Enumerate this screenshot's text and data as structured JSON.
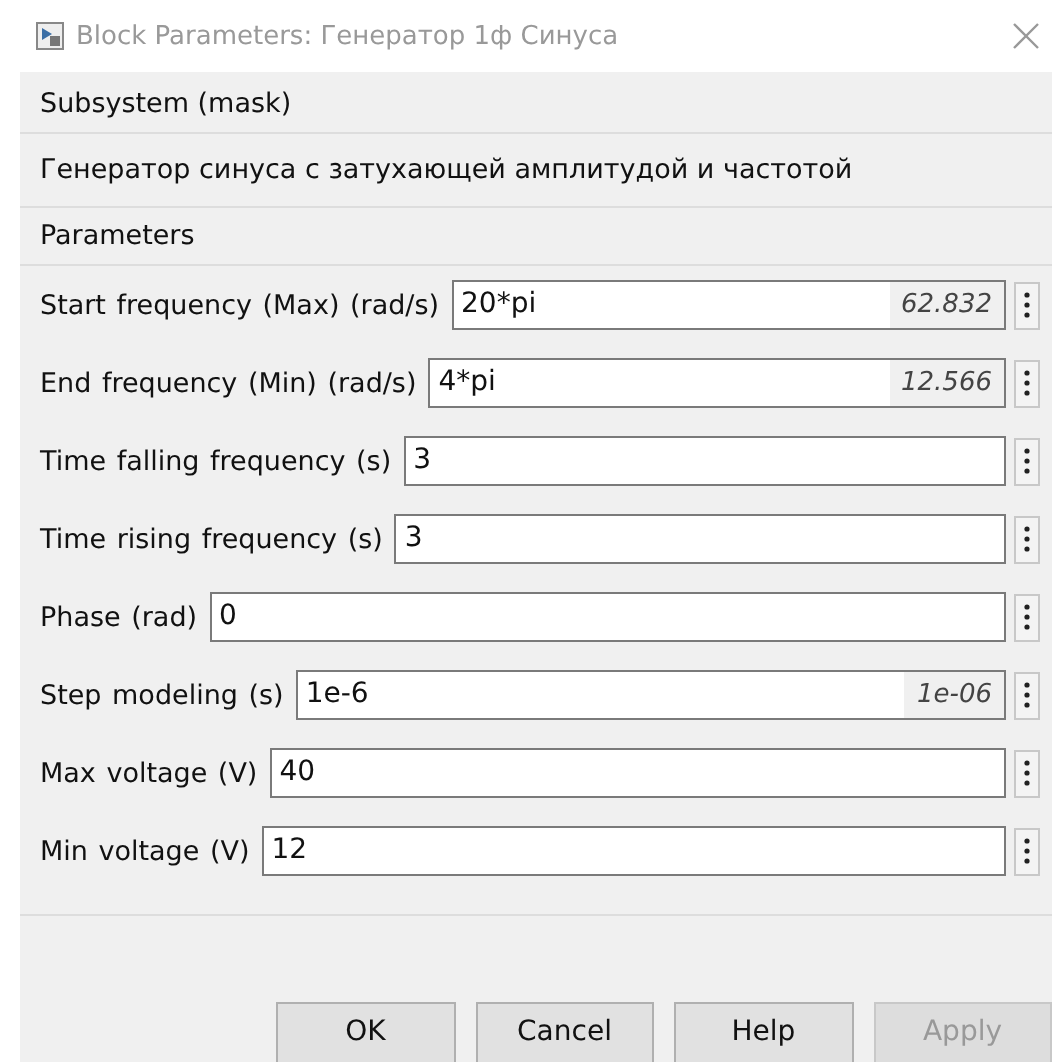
{
  "window": {
    "title": "Block Parameters: Генератор 1ф Синуса"
  },
  "description": {
    "heading": "Subsystem (mask)",
    "text": "Генератор синуса с затухающей амплитудой и частотой"
  },
  "parameters": {
    "heading": "Parameters",
    "fields": [
      {
        "label": "Start  frequency  (Max) (rad/s)",
        "value": "20*pi",
        "evaluated": "62.832"
      },
      {
        "label": "End frequency  (Min) (rad/s)",
        "value": "4*pi",
        "evaluated": "12.566"
      },
      {
        "label": "Time falling frequency  (s)",
        "value": "3"
      },
      {
        "label": "Time rising frequency (s)",
        "value": "3"
      },
      {
        "label": "Phase (rad)",
        "value": "0"
      },
      {
        "label": "Step modeling (s)",
        "value": "1e-6",
        "evaluated": "1e-06"
      },
      {
        "label": "Max voltage (V)",
        "value": "40"
      },
      {
        "label": "Min voltage (V)",
        "value": "12"
      }
    ]
  },
  "buttons": [
    {
      "label": "OK",
      "disabled": false
    },
    {
      "label": "Cancel",
      "disabled": false
    },
    {
      "label": "Help",
      "disabled": false
    },
    {
      "label": "Apply",
      "disabled": true
    }
  ]
}
